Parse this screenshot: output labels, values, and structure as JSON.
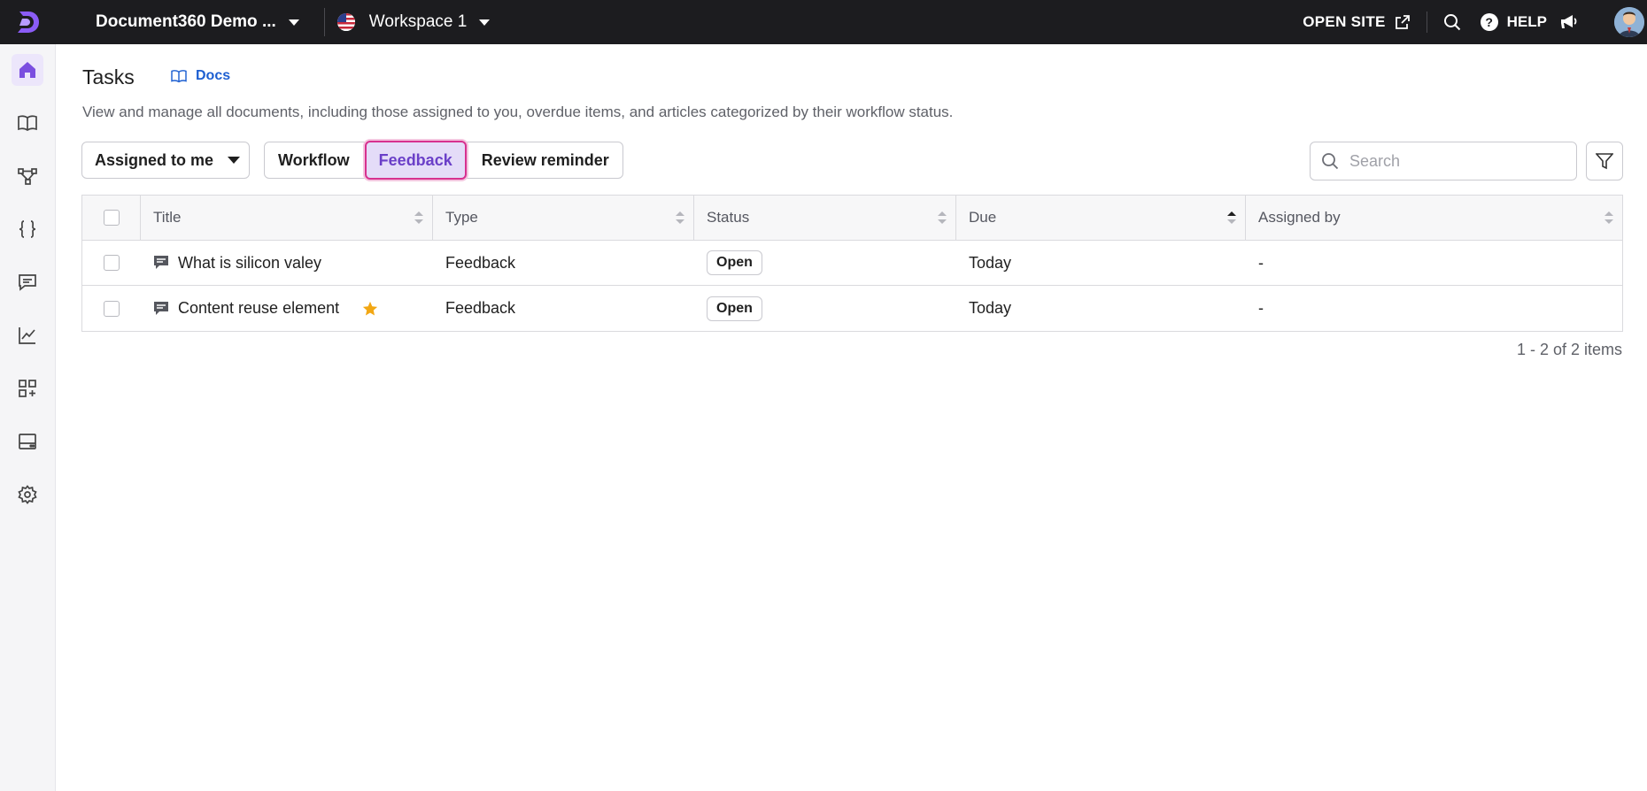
{
  "topbar": {
    "project_name": "Document360 Demo ...",
    "workspace_name": "Workspace 1",
    "open_site_label": "OPEN SITE",
    "help_label": "HELP"
  },
  "sidebar": {
    "items": [
      {
        "icon": "home-icon",
        "active": true
      },
      {
        "icon": "book-icon"
      },
      {
        "icon": "workflow-icon"
      },
      {
        "icon": "curly-braces-icon"
      },
      {
        "icon": "comment-icon"
      },
      {
        "icon": "analytics-icon"
      },
      {
        "icon": "apps-add-icon"
      },
      {
        "icon": "widget-icon"
      },
      {
        "icon": "gear-icon"
      }
    ]
  },
  "page": {
    "title": "Tasks",
    "docs_link": "Docs",
    "subtitle": "View and manage all documents, including those assigned to you, overdue items, and articles categorized by their workflow status."
  },
  "filters": {
    "assigned_dropdown": "Assigned to me",
    "tabs": [
      {
        "label": "Workflow",
        "selected": false
      },
      {
        "label": "Feedback",
        "selected": true
      },
      {
        "label": "Review reminder",
        "selected": false
      }
    ],
    "search_placeholder": "Search"
  },
  "table": {
    "columns": [
      "Title",
      "Type",
      "Status",
      "Due",
      "Assigned by"
    ],
    "rows": [
      {
        "title": "What is silicon valey",
        "starred": false,
        "type": "Feedback",
        "status": "Open",
        "due": "Today",
        "assigned_by": "-"
      },
      {
        "title": "Content reuse element",
        "starred": true,
        "type": "Feedback",
        "status": "Open",
        "due": "Today",
        "assigned_by": "-"
      }
    ]
  },
  "pagination": {
    "summary": "1 - 2 of 2 items"
  },
  "colors": {
    "topbar_bg": "#1c1c1f",
    "accent_purple": "#7b4fe0",
    "selected_tab_bg": "#e4dcf8",
    "highlight_border": "#d7318f",
    "link_blue": "#1d5fd1",
    "star": "#f2a713"
  }
}
